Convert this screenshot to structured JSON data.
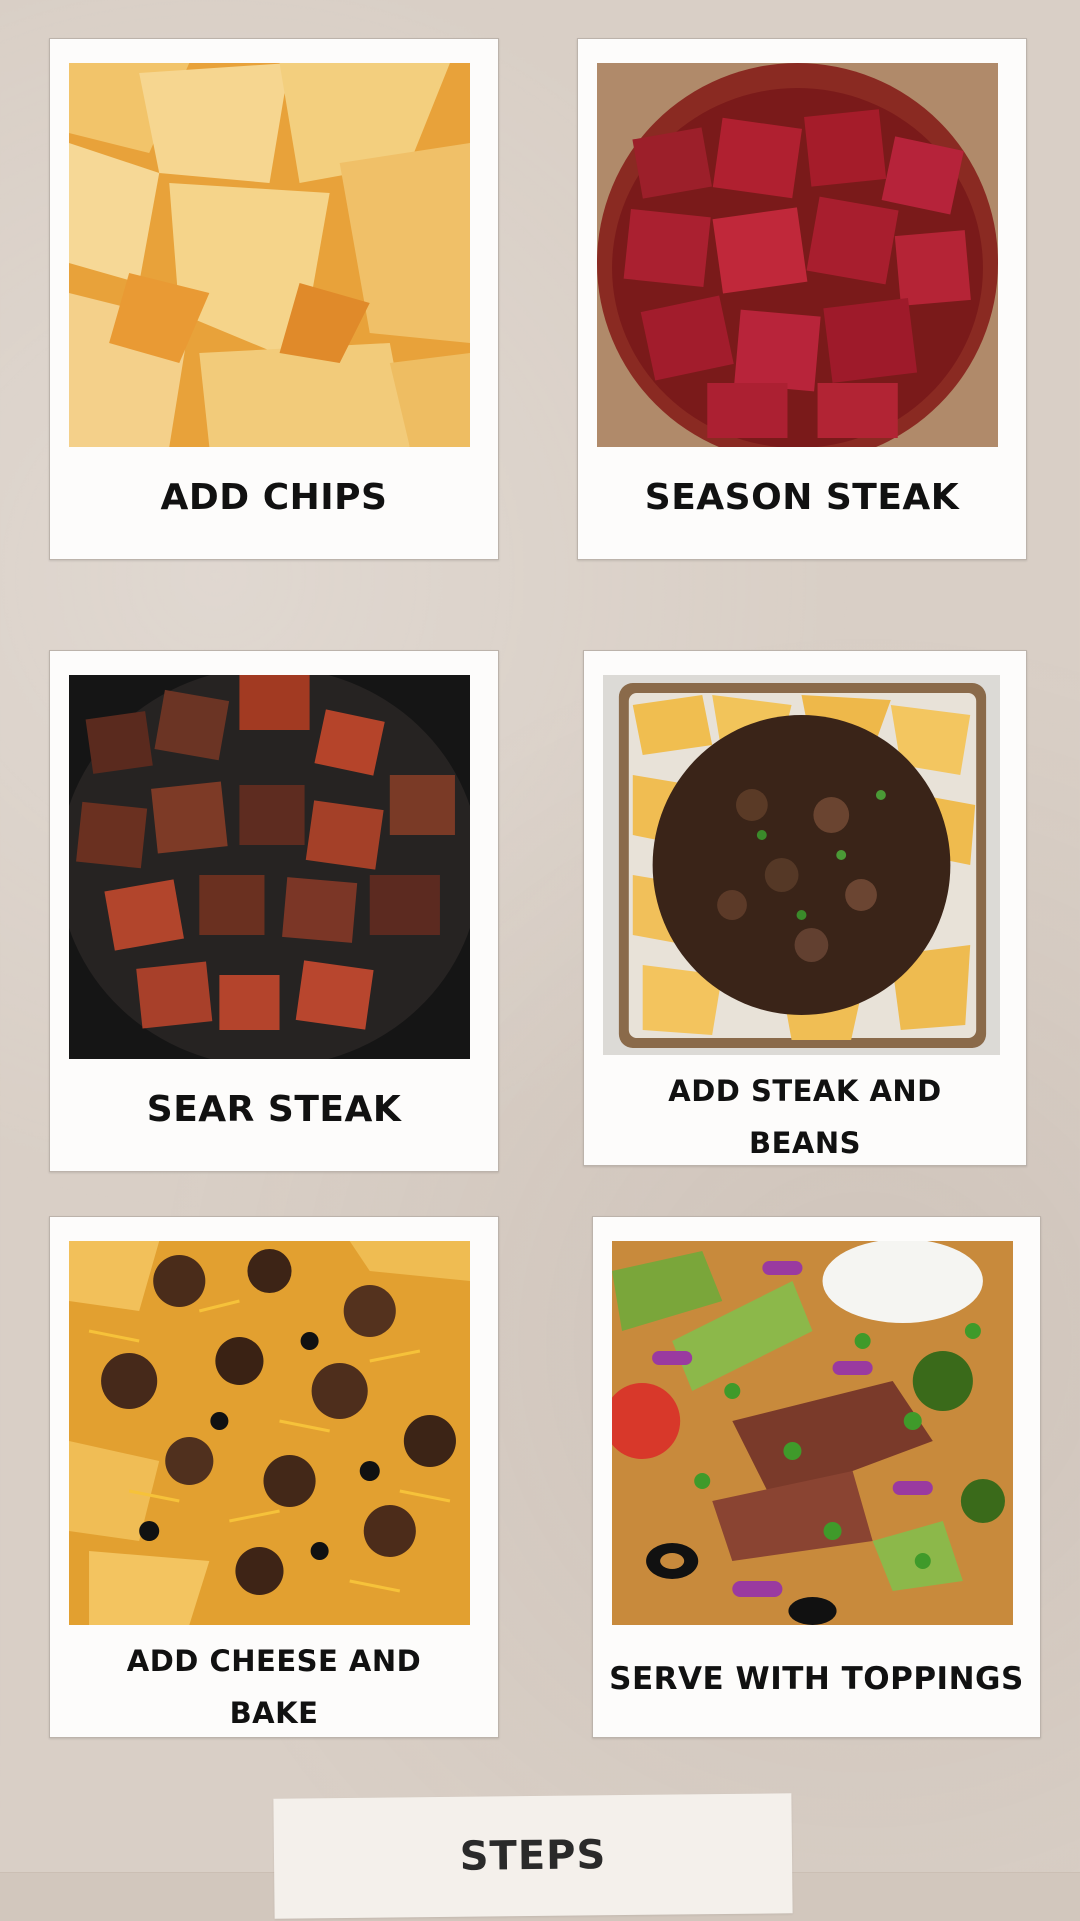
{
  "steps": [
    {
      "label": "ADD CHIPS"
    },
    {
      "label": "SEASON STEAK"
    },
    {
      "label": "SEAR STEAK"
    },
    {
      "label_line1": "ADD STEAK AND",
      "label_line2": "BEANS"
    },
    {
      "label_line1": "ADD CHEESE AND",
      "label_line2": "BAKE"
    },
    {
      "label": "SERVE WITH TOPPINGS"
    }
  ],
  "footer": {
    "label": "STEPS"
  },
  "colors": {
    "background": "#d9cfc6",
    "card": "#fdfcfb",
    "text": "#111111"
  },
  "icons": {
    "photo-1": "tortilla-chips-photo",
    "photo-2": "seasoned-steak-cubes-photo",
    "photo-3": "seared-steak-skillet-photo",
    "photo-4": "nachos-steak-beans-tray-photo",
    "photo-5": "nachos-cheese-bake-photo",
    "photo-6": "nachos-toppings-photo"
  }
}
